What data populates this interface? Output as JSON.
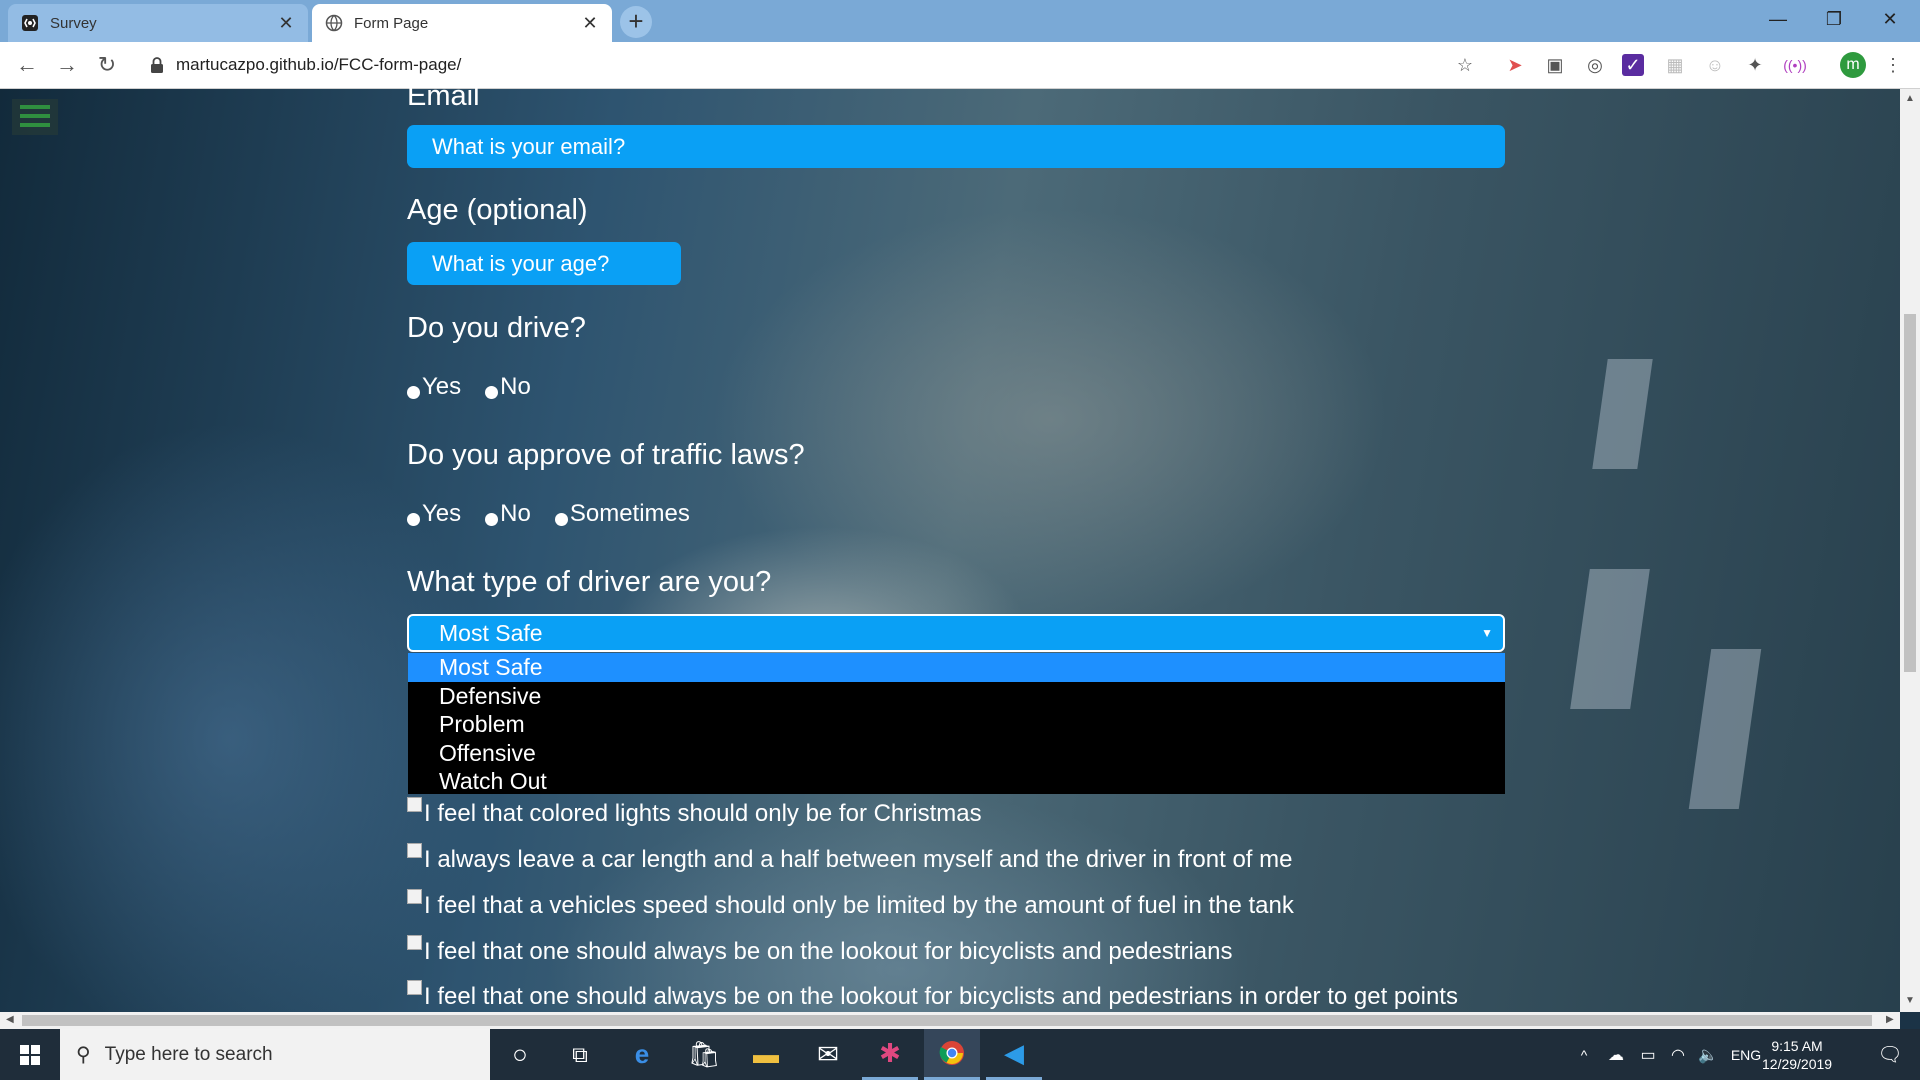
{
  "browser": {
    "tabs": [
      {
        "title": "Survey",
        "state": "inactive"
      },
      {
        "title": "Form Page",
        "state": "active"
      }
    ],
    "url": "martucazpo.github.io/FCC-form-page/"
  },
  "form": {
    "email": {
      "label": "Email",
      "placeholder": "What is your email?"
    },
    "age": {
      "label": "Age (optional)",
      "placeholder": "What is your age?"
    },
    "drive": {
      "label": "Do you drive?",
      "options": [
        "Yes",
        "No"
      ]
    },
    "traffic_laws": {
      "label": "Do you approve of traffic laws?",
      "options": [
        "Yes",
        "No",
        "Sometimes"
      ]
    },
    "driver_type": {
      "label": "What type of driver are you?",
      "selected": "Most Safe",
      "options": [
        "Most Safe",
        "Defensive",
        "Problem",
        "Offensive",
        "Watch Out"
      ]
    },
    "statements": [
      "I feel that colored lights should only be for Christmas",
      "I always leave a car length and a half between myself and the driver in front of me",
      "I feel that a vehicles speed should only be limited by the amount of fuel in the tank",
      "I feel that one should always be on the lookout for bicyclists and pedestrians",
      "I feel that one should always be on the lookout for bicyclists and pedestrians in order to get points"
    ]
  },
  "taskbar": {
    "search_placeholder": "Type here to search",
    "language": "ENG",
    "time": "9:15 AM",
    "date": "12/29/2019"
  },
  "colors": {
    "input_bg": "#0aa0f5",
    "dropdown_bg": "#000000",
    "dropdown_selected": "#1e90ff"
  }
}
